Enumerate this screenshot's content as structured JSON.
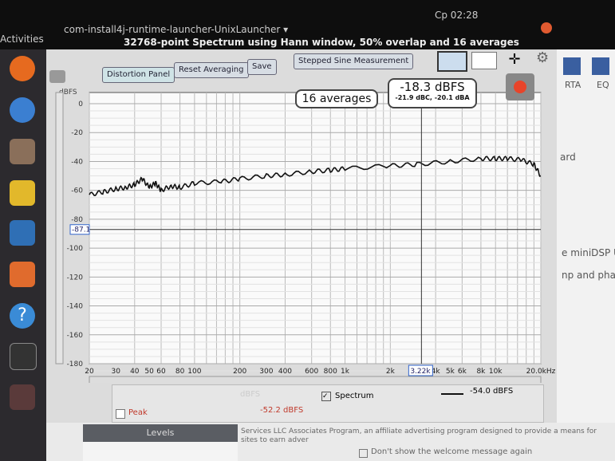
{
  "topbar": {
    "activities": "Activities",
    "app_name": "com-install4j-runtime-launcher-UnixLauncher ▾",
    "clock": "Cp 02:28"
  },
  "window": {
    "title": "32768-point Spectrum using Hann window, 50% overlap and 16 averages"
  },
  "toolbar": {
    "distortion": "Distortion Panel",
    "reset": "Reset Averaging",
    "save": "Save",
    "stepped": "Stepped Sine Measurement"
  },
  "readouts": {
    "averages": "16 averages",
    "level": "-18.3 dBFS",
    "weighted": "-21.9 dBC, -20.1 dBA",
    "cursor_freq": "3.22k",
    "cursor_level": "-87.1"
  },
  "right_panel": {
    "rta": "RTA",
    "eq": "EQ",
    "frag1": "ard",
    "frag2": "e miniDSP U",
    "frag3": "np and pha"
  },
  "legend": {
    "spectrum": "Spectrum",
    "spectrum_value": "-54.0 dBFS",
    "peak": "Peak",
    "peak_value": "-52.2 dBFS",
    "faded": "dBFS"
  },
  "levels": {
    "title": "Levels"
  },
  "footer": {
    "text": "Services LLC Associates Program, an affiliate advertising program designed to provide a means for sites to earn adver",
    "checkbox": "Don't show the welcome message again"
  },
  "colors": {
    "trace": "#111111",
    "record": "#e8442a",
    "peak_text": "#c0392b"
  },
  "chart_data": {
    "type": "line",
    "ylabel": "dBFS",
    "xscale": "log",
    "xlim": [
      20,
      20000
    ],
    "ylim": [
      -180,
      0
    ],
    "grid": true,
    "yticks": [
      "0",
      "-20",
      "-40",
      "-60",
      "-80",
      "-100",
      "-120",
      "-140",
      "-160",
      "-180"
    ],
    "xticks": [
      {
        "v": 20,
        "l": "20"
      },
      {
        "v": 30,
        "l": "30"
      },
      {
        "v": 40,
        "l": "40"
      },
      {
        "v": 50,
        "l": "50"
      },
      {
        "v": 60,
        "l": "60"
      },
      {
        "v": 80,
        "l": "80"
      },
      {
        "v": 100,
        "l": "100"
      },
      {
        "v": 200,
        "l": "200"
      },
      {
        "v": 300,
        "l": "300"
      },
      {
        "v": 400,
        "l": "400"
      },
      {
        "v": 600,
        "l": "600"
      },
      {
        "v": 800,
        "l": "800"
      },
      {
        "v": 1000,
        "l": "1k"
      },
      {
        "v": 2000,
        "l": "2k"
      },
      {
        "v": 4000,
        "l": "4k"
      },
      {
        "v": 5000,
        "l": "5k"
      },
      {
        "v": 6000,
        "l": "6k"
      },
      {
        "v": 8000,
        "l": "8k"
      },
      {
        "v": 10000,
        "l": "10k"
      },
      {
        "v": 20000,
        "l": "20.0kHz"
      }
    ],
    "series": [
      {
        "x": [
          20,
          25,
          30,
          35,
          40,
          45,
          50,
          55,
          60,
          70,
          80,
          100,
          150,
          200,
          300,
          400,
          600,
          800,
          1000,
          2000,
          3000,
          5000,
          8000,
          10000,
          12000,
          15000,
          18000,
          20000
        ],
        "y": [
          -63,
          -61,
          -59,
          -58,
          -56,
          -52,
          -58,
          -55,
          -60,
          -57,
          -58,
          -55,
          -54,
          -52,
          -50,
          -49,
          -47,
          -46,
          -45,
          -43,
          -42,
          -40,
          -38,
          -38,
          -38,
          -39,
          -42,
          -50
        ]
      }
    ],
    "cursor": {
      "x": 3220,
      "y": -87.1
    }
  }
}
